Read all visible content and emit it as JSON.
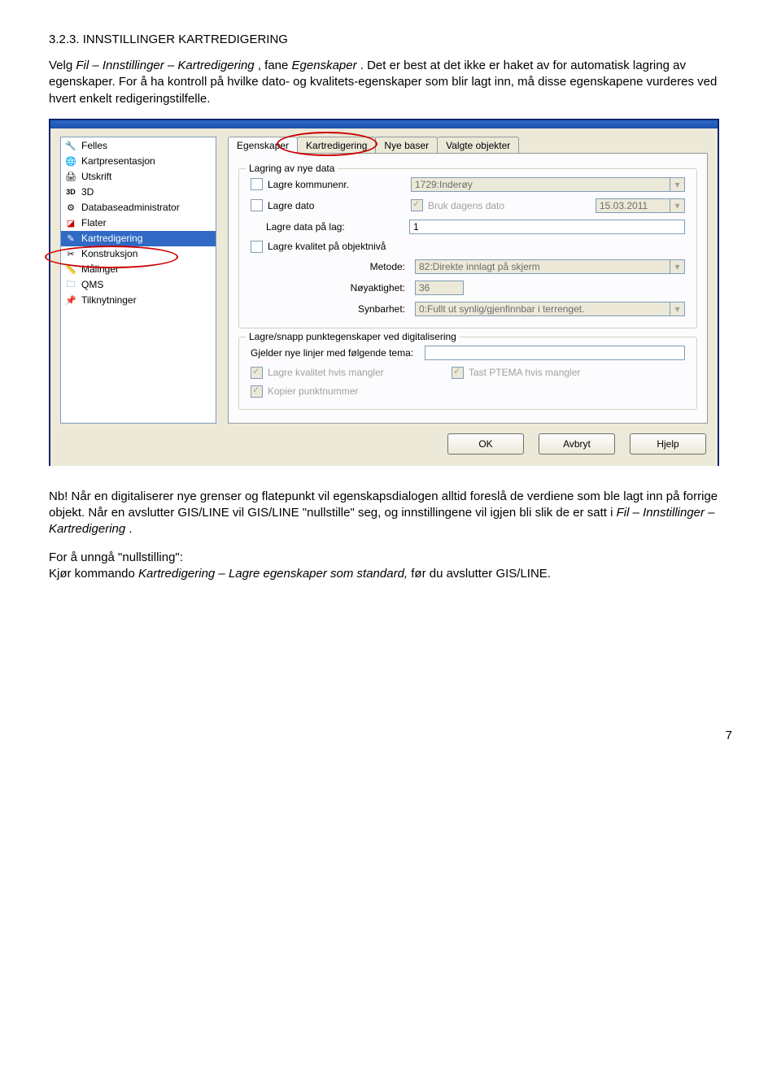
{
  "heading": "3.2.3.   INNSTILLINGER KARTREDIGERING",
  "intro1_a": "Velg ",
  "intro1_b": "Fil – Innstillinger – Kartredigering",
  "intro1_c": ", fane ",
  "intro1_d": "Egenskaper",
  "intro1_e": ". Det er best at det ikke er haket av for automatisk lagring av egenskaper. For å ha kontroll på hvilke dato- og kvalitets-egenskaper som blir lagt inn, må disse egenskapene vurderes ved hvert enkelt redigeringstilfelle.",
  "sidebar": {
    "items": [
      {
        "label": "Felles",
        "icon": "🔧"
      },
      {
        "label": "Kartpresentasjon",
        "icon": "🌐"
      },
      {
        "label": "Utskrift",
        "icon": "🖨"
      },
      {
        "label": "3D",
        "icon": "3D"
      },
      {
        "label": "Databaseadministrator",
        "icon": "⚙"
      },
      {
        "label": "Flater",
        "icon": "◪"
      },
      {
        "label": "Kartredigering",
        "icon": "✎"
      },
      {
        "label": "Konstruksjon",
        "icon": "✂"
      },
      {
        "label": "Målinger",
        "icon": "📏"
      },
      {
        "label": "QMS",
        "icon": "🗀"
      },
      {
        "label": "Tilknytninger",
        "icon": "📌"
      }
    ]
  },
  "tabs": [
    "Egenskaper",
    "Kartredigering",
    "Nye baser",
    "Valgte objekter"
  ],
  "group1": {
    "legend": "Lagring av nye data",
    "lagre_kommunenr": "Lagre kommunenr.",
    "kommune_val": "1729:Inderøy",
    "lagre_dato": "Lagre dato",
    "bruk_dagens": "Bruk dagens dato",
    "dato_val": "15.03.2011",
    "lagre_data_lag": "Lagre data på lag:",
    "lag_val": "1",
    "lagre_kvalitet": "Lagre kvalitet på objektnivå",
    "metode_lbl": "Metode:",
    "metode_val": "82:Direkte innlagt på skjerm",
    "noy_lbl": "Nøyaktighet:",
    "noy_val": "36",
    "syn_lbl": "Synbarhet:",
    "syn_val": "0:Fullt ut synlig/gjenfinnbar i terrenget."
  },
  "group2": {
    "legend": "Lagre/snapp punktegenskaper ved digitalisering",
    "gjelder": "Gjelder nye linjer med følgende tema:",
    "lagre_kvalitet_mangler": "Lagre kvalitet hvis mangler",
    "tast_ptema": "Tast PTEMA hvis mangler",
    "kopier_punktnr": "Kopier punktnummer"
  },
  "buttons": {
    "ok": "OK",
    "avbryt": "Avbryt",
    "hjelp": "Hjelp"
  },
  "outro1_a": "Nb! ",
  "outro1_b": "Når en digitaliserer nye grenser og flatepunkt vil egenskapsdialogen alltid foreslå de verdiene som ble lagt inn på forrige objekt. Når en avslutter GIS/LINE vil GIS/LINE \"nullstille\" seg, og innstillingene vil igjen bli slik de er satt i ",
  "outro1_c": "Fil – Innstillinger – Kartredigering",
  "outro1_d": ".",
  "outro2_a": "For å unngå \"nullstilling\":",
  "outro2_b": "Kjør kommando ",
  "outro2_c": "Kartredigering – Lagre egenskaper som standard, ",
  "outro2_d": "før du avslutter GIS/LINE.",
  "page_num": "7"
}
